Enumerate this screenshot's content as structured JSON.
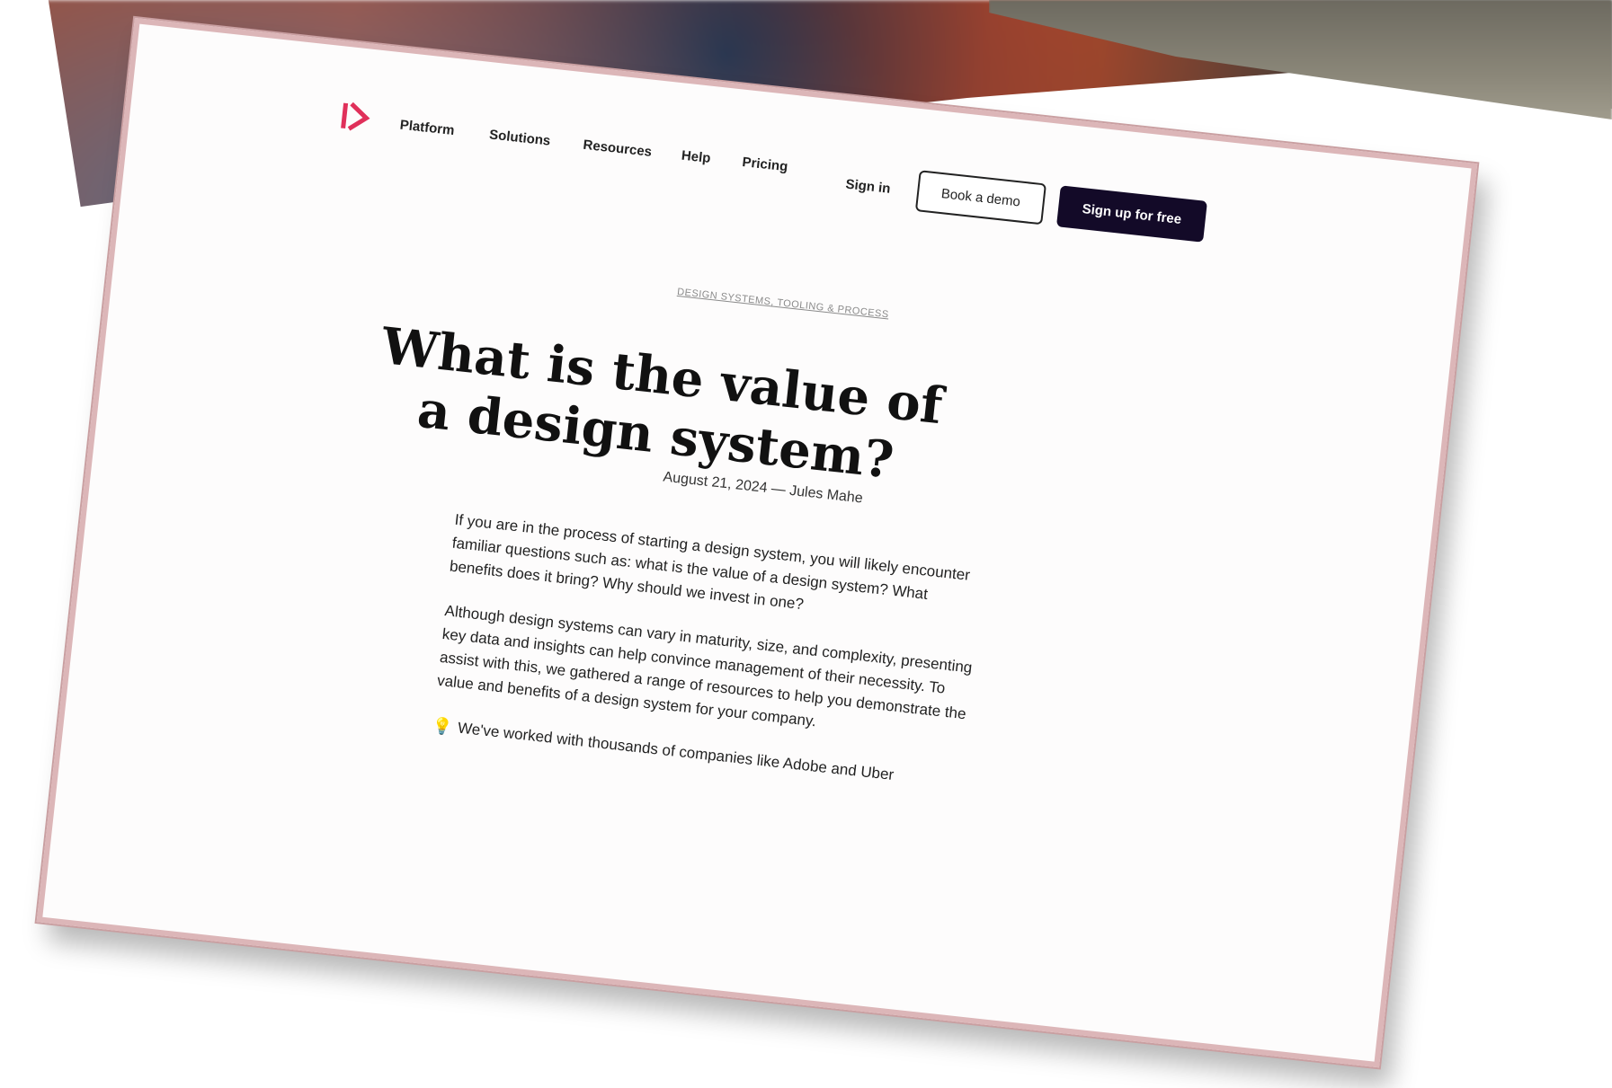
{
  "nav": {
    "links": [
      "Platform",
      "Solutions",
      "Resources",
      "Help",
      "Pricing"
    ],
    "sign_in": "Sign in",
    "book_demo": "Book a demo",
    "sign_up": "Sign up for free"
  },
  "article": {
    "tags": "DESIGN SYSTEMS, TOOLING & PROCESS",
    "title": "What is the value of a design system?",
    "meta": "August 21, 2024 — Jules Mahe",
    "paragraphs": [
      "If you are in the process of starting a design system, you will likely encounter familiar questions such as: what is the value of a design system? What benefits does it bring? Why should we invest in one?",
      "Although design systems can vary in maturity, size, and complexity, presenting key data and insights can help convince management of their necessity. To assist with this, we gathered a range of resources to help you demonstrate the value and benefits of a design system for your company."
    ],
    "callout": "We've worked with thousands of companies like Adobe and Uber"
  },
  "colors": {
    "accent": "#e0305a",
    "button_dark": "#130a28",
    "page_border": "#dcb6b8"
  }
}
